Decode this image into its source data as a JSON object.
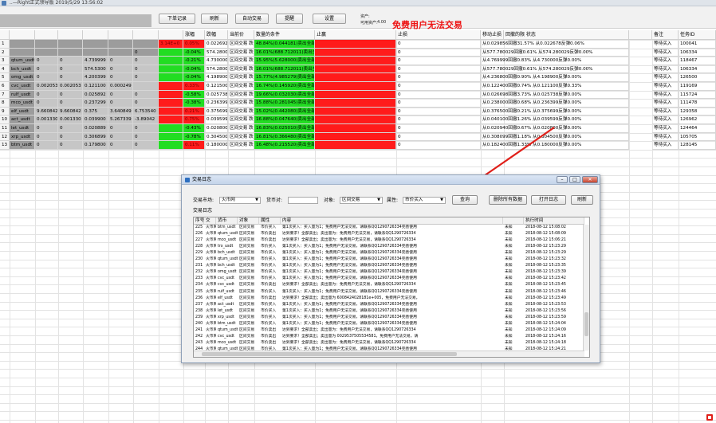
{
  "window": {
    "title": "..—Right正式领导版 2019/5/29 13:56:02"
  },
  "toolbar": {
    "buttons": [
      "下单记录",
      "刷新",
      "自动交易",
      "提醒",
      "设置"
    ],
    "balance_label": "资产:",
    "available_label": "可用资产:",
    "available_value": "4.00",
    "free_notice": "免费用户无法交易"
  },
  "table": {
    "headers": [
      "",
      "",
      "",
      "",
      "",
      "",
      "",
      "",
      "涨幅",
      "跌幅",
      "当前价",
      "数量的条件",
      "止赢",
      "止损",
      "移动止损",
      "回撤的限 状态",
      "",
      "备注",
      "任务ID"
    ],
    "rows": [
      {
        "n": "1",
        "sym": "",
        "a": "",
        "b": "",
        "c": "",
        "d": "",
        "e": "",
        "up": "3.14E+0",
        "dn": "0.05%",
        "price": "0.022692",
        "cond": "区间交易 跌0.1%买 涨0.1%卖",
        "tp": "48.84%(0.044181)卖出全部",
        "sl": "",
        "mv": "0",
        "ret": "从0.029856回撤31.57% 从0.022678反弹0.06%",
        "note": "等待买入",
        "id": "100041"
      },
      {
        "n": "2",
        "sym": "",
        "a": "",
        "b": "",
        "c": "",
        "d": "",
        "e": "0",
        "up": "",
        "dn": "-0.04%",
        "price": "574.2800",
        "cond": "区间交易 跌0.1%买 涨0.1%卖",
        "tp": "16.01%(688.712011)卖出全部",
        "sl": "",
        "mv": "0",
        "ret": "从577.780029回撤0.61% 从574.280029反弹0.00%",
        "note": "等待买入",
        "id": "106334"
      },
      {
        "n": "3",
        "sym": "qtum_usdt",
        "a": "0",
        "b": "0",
        "c": "4.739999",
        "d": "0",
        "e": "0",
        "up": "",
        "dn": "-0.21%",
        "price": "4.730000",
        "cond": "区间交易 跌0.1%买 涨0.1%卖",
        "tp": "15.95%(5.628000)卖出全部",
        "sl": "",
        "mv": "0",
        "ret": "从4.769999回撤0.83% 从4.730000反弹0.00%",
        "note": "等待买入",
        "id": "118467"
      },
      {
        "n": "4",
        "sym": "bch_usdt",
        "a": "0",
        "b": "0",
        "c": "574.5300",
        "d": "0",
        "e": "0",
        "up": "",
        "dn": "-0.04%",
        "price": "574.2800",
        "cond": "区间交易 跌0.1%买 涨0.1%卖",
        "tp": "16.01%(688.712011)卖出全部",
        "sl": "",
        "mv": "0",
        "ret": "从577.780029回撤0.61% 从574.280029反弹0.00%",
        "note": "等待买入",
        "id": "106334"
      },
      {
        "n": "5",
        "sym": "omg_usdt",
        "a": "0",
        "b": "0",
        "c": "4.200399",
        "d": "0",
        "e": "0",
        "up": "",
        "dn": "-0.04%",
        "price": "4.198900",
        "cond": "区间交易 跌0.1%买 涨0.1%卖",
        "tp": "15.77%(4.985279)卖出全部",
        "sl": "",
        "mv": "0",
        "ret": "从4.236800回撤0.90% 从4.198900反弹0.00%",
        "note": "等待买入",
        "id": "126500"
      },
      {
        "n": "6",
        "sym": "cvc_usdt",
        "a": "0.002053",
        "b": "0.002053",
        "c": "0.121100",
        "d": "0.000249",
        "e": "",
        "up": "",
        "dn": "0.33%",
        "price": "0.121500",
        "cond": "区间交易 跌0.1%买 涨0.1%卖",
        "tp": "16.74%(0.145920)卖出全部",
        "sl": "",
        "mv": "0",
        "ret": "从0.122400回撤0.74% 从0.121100反弹0.33%",
        "note": "等待买入",
        "id": "119169"
      },
      {
        "n": "7",
        "sym": "rulf_usdt",
        "a": "0",
        "b": "0",
        "c": "0.025892",
        "d": "0",
        "e": "0",
        "up": "",
        "dn": "-0.58%",
        "price": "0.025738",
        "cond": "区间交易 跌0.1%买 涨0.1%卖",
        "tp": "19.66%(0.032030)卖出全部",
        "sl": "",
        "mv": "0",
        "ret": "从0.026698回撤3.73% 从0.025738反弹0.00%",
        "note": "等待买入",
        "id": "115724"
      },
      {
        "n": "8",
        "sym": "mco_usdt",
        "a": "0",
        "b": "0",
        "c": "0.237299",
        "d": "0",
        "e": "0",
        "up": "",
        "dn": "-0.38%",
        "price": "0.236399",
        "cond": "区间交易 跌0.1%买 涨0.1%卖",
        "tp": "15.88%(0.281045)卖出全部",
        "sl": "",
        "mv": "0",
        "ret": "从0.238000回撤0.68% 从0.236399反弹0.00%",
        "note": "等待买入",
        "id": "111478"
      },
      {
        "n": "9",
        "sym": "elf_usdt",
        "a": "9.660842",
        "b": "9.660842",
        "c": "0.375",
        "d": "3.640849",
        "e": "6.753540",
        "up": "",
        "dn": "0.21%",
        "price": "0.375699",
        "cond": "区间交易 跌0.1%买 涨0.1%卖",
        "tp": "15.02%(0.442080)卖出全部",
        "sl": "",
        "mv": "0",
        "ret": "从0.376500回撤0.21% 从0.375699反弹0.00%",
        "note": "等待买入",
        "id": "129358"
      },
      {
        "n": "10",
        "sym": "act_usdt",
        "a": "0.001330",
        "b": "0.001330",
        "c": "0.039900",
        "d": "5.267339",
        "e": "-3.89042",
        "up": "",
        "dn": "0.75%",
        "price": "0.039599",
        "cond": "区间交易 跌0.1%买 涨0.1%卖",
        "tp": "16.88%(0.047640)卖出全部",
        "sl": "",
        "mv": "0",
        "ret": "从0.040100回撤1.26% 从0.039599反弹0.00%",
        "note": "等待买入",
        "id": "126962"
      },
      {
        "n": "11",
        "sym": "let_usdt",
        "a": "0",
        "b": "0",
        "c": "0.020889",
        "d": "0",
        "e": "0",
        "up": "",
        "dn": "-0.43%",
        "price": "0.020800",
        "cond": "区间交易 跌0.1%买 涨0.1%卖",
        "tp": "16.83%(0.025010)卖出全部",
        "sl": "",
        "mv": "0",
        "ret": "从0.020940回撤0.67% 从0.020800反弹0.00%",
        "note": "等待买入",
        "id": "124464"
      },
      {
        "n": "12",
        "sym": "xrp_usdt",
        "a": "0",
        "b": "0",
        "c": "0.306899",
        "d": "0",
        "e": "0",
        "up": "",
        "dn": "-0.78%",
        "price": "0.304500",
        "cond": "区间交易 跌0.1%买 涨0.1%卖",
        "tp": "16.81%(0.366480)卖出全部",
        "sl": "",
        "mv": "0",
        "ret": "从0.308099回撤1.18% 从0.304500反弹0.00%",
        "note": "等待买入",
        "id": "105705"
      },
      {
        "n": "13",
        "sym": "btm_usdt",
        "a": "0",
        "b": "0",
        "c": "0.179800",
        "d": "0",
        "e": "0",
        "up": "",
        "dn": "0.11%",
        "price": "0.180000",
        "cond": "区间交易 跌0.1%买 涨0.1%卖",
        "tp": "16.48%(0.215520)卖出全部",
        "sl": "",
        "mv": "0",
        "ret": "从0.182400回撤1.33% 从0.180000反弹0.00%",
        "note": "等待买入",
        "id": "128145"
      }
    ]
  },
  "dialog": {
    "title": "交易日志",
    "market_label": "交易市场:",
    "market_value": "火币网",
    "symbol_label": "货币对:",
    "symbol_value": "",
    "object_label": "对象:",
    "object_value": "区间交易",
    "attr_label": "属性:",
    "attr_value": "市价买入",
    "buttons": [
      "查询",
      "删除所有数据",
      "打开日志",
      "刷新"
    ],
    "log_title": "交易日志",
    "columns": [
      "序号",
      "交",
      "货币",
      "对象",
      "属性",
      "内容",
      "",
      "",
      "",
      "",
      "",
      "",
      "",
      "",
      "",
      "执行时间"
    ],
    "rows": [
      {
        "no": "225",
        "ex": "火币网",
        "sym": "btm_usdt",
        "obj": "区间交易",
        "attr": "市价买入",
        "msg": "第1次买入：买入量为1；免费用户无法交易，请联系QQ1290726334完善使用",
        "st": "未知",
        "time": "2018-08-12 15:08:02"
      },
      {
        "no": "226",
        "ex": "火币网",
        "sym": "qtum_usdt",
        "obj": "区间交易",
        "attr": "市价卖出",
        "msg": "达到要求！全部卖出；卖出量为：免费用户无法交易，请联系QQ1290726334",
        "st": "未知",
        "time": "2018-08-12 15:08:09"
      },
      {
        "no": "227",
        "ex": "火币网",
        "sym": "mco_usdt",
        "obj": "区间交易",
        "attr": "市价卖出",
        "msg": "达到要求！全部卖出；卖出量为：免费用户无法交易，请联系QQ1290726334",
        "st": "未知",
        "time": "2018-08-12 15:06:21"
      },
      {
        "no": "228",
        "ex": "火币网",
        "sym": "trx_usdt",
        "obj": "区间交易",
        "attr": "市价买入",
        "msg": "第1次买入：买入量为1；免费用户无法交易，请联系QQ1290726334完善使用",
        "st": "未知",
        "time": "2018-08-12 15:23:29"
      },
      {
        "no": "229",
        "ex": "火币网",
        "sym": "bch_usdt",
        "obj": "区间交易",
        "attr": "市价买入",
        "msg": "第1次买入：买入量为1；免费用户无法交易，请联系QQ1290726334完善使用",
        "st": "未知",
        "time": "2018-08-12 15:23:29"
      },
      {
        "no": "230",
        "ex": "火币网",
        "sym": "qtum_usdt",
        "obj": "区间交易",
        "attr": "市价买入",
        "msg": "第1次买入：买入量为1；免费用户无法交易，请联系QQ1290726334完善使用",
        "st": "未知",
        "time": "2018-08-12 15:23:32"
      },
      {
        "no": "231",
        "ex": "火币网",
        "sym": "bch_usdt",
        "obj": "区间交易",
        "attr": "市价买入",
        "msg": "第1次买入：买入量为1；免费用户无法交易，请联系QQ1290726334完善使用",
        "st": "未知",
        "time": "2018-08-12 15:23:35"
      },
      {
        "no": "232",
        "ex": "火币网",
        "sym": "omg_usdt",
        "obj": "区间交易",
        "attr": "市价买入",
        "msg": "第1次买入：买入量为1；免费用户无法交易，请联系QQ1290726334完善使用",
        "st": "未知",
        "time": "2018-08-12 15:23:39"
      },
      {
        "no": "233",
        "ex": "火币网",
        "sym": "cvc_usdt",
        "obj": "区间交易",
        "attr": "市价买入",
        "msg": "第1次买入：买入量为1；免费用户无法交易，请联系QQ1290726334完善使用",
        "st": "未知",
        "time": "2018-08-12 15:23:42"
      },
      {
        "no": "234",
        "ex": "火币网",
        "sym": "cvc_usdt",
        "obj": "区间交易",
        "attr": "市价卖出",
        "msg": "达到要求！全部卖出；卖出量为：免费用户无法交易，请联系QQ1290726334",
        "st": "未知",
        "time": "2018-08-12 15:23:45"
      },
      {
        "no": "235",
        "ex": "火币网",
        "sym": "rulf_usdt",
        "obj": "区间交易",
        "attr": "市价买入",
        "msg": "第1次买入：买入量为1；免费用户无法交易，请联系QQ1290726334完善使用",
        "st": "未知",
        "time": "2018-08-12 15:23:46"
      },
      {
        "no": "236",
        "ex": "火币网",
        "sym": "elf_usdt",
        "obj": "区间交易",
        "attr": "市价卖出",
        "msg": "达到要求！全部卖出；卖出量为 6008424028181e+005，免费用户无法交易，",
        "st": "未知",
        "time": "2018-08-12 15:23:49"
      },
      {
        "no": "237",
        "ex": "火币网",
        "sym": "act_usdt",
        "obj": "区间交易",
        "attr": "市价买入",
        "msg": "第1次买入：买入量为1；免费用户无法交易，请联系QQ1290726334完善使用",
        "st": "未知",
        "time": "2018-08-12 15:23:53"
      },
      {
        "no": "238",
        "ex": "火币网",
        "sym": "let_usdt",
        "obj": "区间交易",
        "attr": "市价买入",
        "msg": "第1次买入：买入量为1；免费用户无法交易，请联系QQ1290726334完善使用",
        "st": "未知",
        "time": "2018-08-12 15:23:56"
      },
      {
        "no": "239",
        "ex": "火币网",
        "sym": "xrp_usdt",
        "obj": "区间交易",
        "attr": "市价买入",
        "msg": "第1次买入：买入量为1；免费用户无法交易，请联系QQ1290726334完善使用",
        "st": "未知",
        "time": "2018-08-12 15:23:59"
      },
      {
        "no": "240",
        "ex": "火币网",
        "sym": "btm_usdt",
        "obj": "区间交易",
        "attr": "市价买入",
        "msg": "第1次买入：买入量为1；免费用户无法交易，请联系QQ1290726334完善使用",
        "st": "未知",
        "time": "2018-08-12 15:24:04"
      },
      {
        "no": "241",
        "ex": "火币网",
        "sym": "qtum_usdt",
        "obj": "区间交易",
        "attr": "市价卖出",
        "msg": "达到要求！全部卖出；卖出量为：免费用户无法交易，请联系QQ1290726334",
        "st": "未知",
        "time": "2018-08-12 15:24:09"
      },
      {
        "no": "242",
        "ex": "火币网",
        "sym": "cvc_usdt",
        "obj": "区间交易",
        "attr": "市价卖出",
        "msg": "达到要求！全部卖出；卖出量为 0029537505534581，免费用户无法交易，请",
        "st": "未知",
        "time": "2018-08-12 15:24:16"
      },
      {
        "no": "243",
        "ex": "火币网",
        "sym": "mco_usdt",
        "obj": "区间交易",
        "attr": "市价卖出",
        "msg": "达到要求！全部卖出；卖出量为：免费用户无法交易，请联系QQ1290726334",
        "st": "未知",
        "time": "2018-08-12 15:24:18"
      },
      {
        "no": "244",
        "ex": "火币网",
        "sym": "qtum_usdt",
        "obj": "区间交易",
        "attr": "市价买入",
        "msg": "第1次买入：买入量为1；免费用户无法交易，请联系QQ1290726334完善使用",
        "st": "未知",
        "time": "2018-08-12 15:24:21"
      }
    ]
  },
  "colors": {
    "green": "#22dd22",
    "red": "#ff1b1b",
    "banner": "#ee1111",
    "arrow": "#e0201a",
    "gray": "#9c9c9c"
  }
}
